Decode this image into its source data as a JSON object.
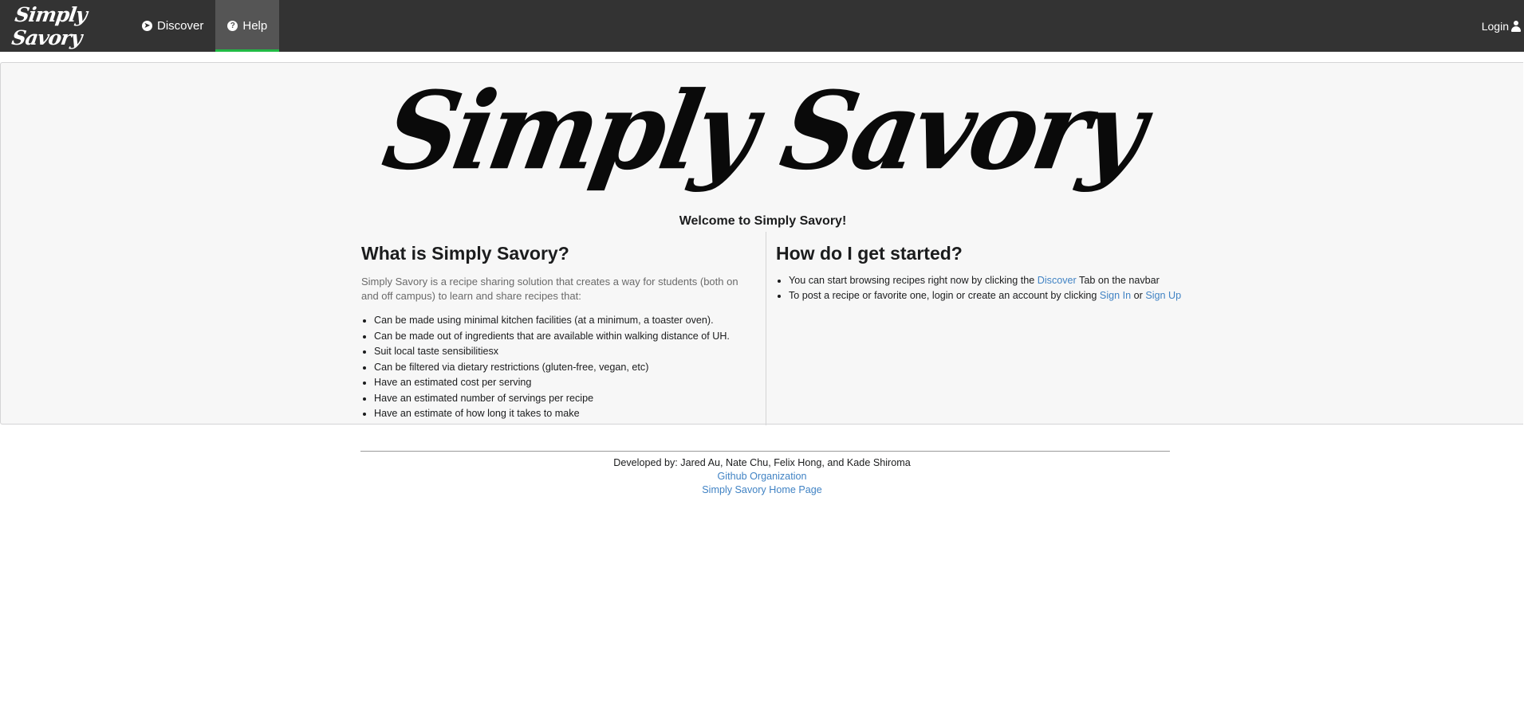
{
  "nav": {
    "brand": "Simply Savory",
    "items": [
      {
        "label": "Discover",
        "icon": "compass-icon"
      },
      {
        "label": "Help",
        "icon": "question-circle-icon",
        "active": true
      }
    ],
    "login_label": "Login",
    "accent": "#21ba45"
  },
  "hero": {
    "logo_text": "Simply Savory",
    "welcome": "Welcome to Simply Savory!"
  },
  "left": {
    "heading": "What is Simply Savory?",
    "intro": "Simply Savory is a recipe sharing solution that creates a way for students (both on and off campus) to learn and share recipes that:",
    "items": [
      "Can be made using minimal kitchen facilities (at a minimum, a toaster oven).",
      "Can be made out of ingredients that are available within walking distance of UH.",
      "Suit local taste sensibilitiesx",
      "Can be filtered via dietary restrictions (gluten-free, vegan, etc)",
      "Have an estimated cost per serving",
      "Have an estimated number of servings per recipe",
      "Have an estimate of how long it takes to make"
    ]
  },
  "right": {
    "heading": "How do I get started?",
    "item1": {
      "before": "You can start browsing recipes right now by clicking the ",
      "link": "Discover",
      "after": " Tab on the navbar"
    },
    "item2": {
      "before": "To post a recipe or favorite one, login or create an account by clicking ",
      "link1": "Sign In",
      "middle": " or ",
      "link2": "Sign Up"
    }
  },
  "footer": {
    "developers": "Developed by: Jared Au, Nate Chu, Felix Hong, and Kade Shiroma",
    "github_link": "Github Organization",
    "home_link": "Simply Savory Home Page"
  },
  "colors": {
    "navbar": "#333333",
    "link": "#4183c4",
    "segment_bg": "#f7f7f7"
  }
}
